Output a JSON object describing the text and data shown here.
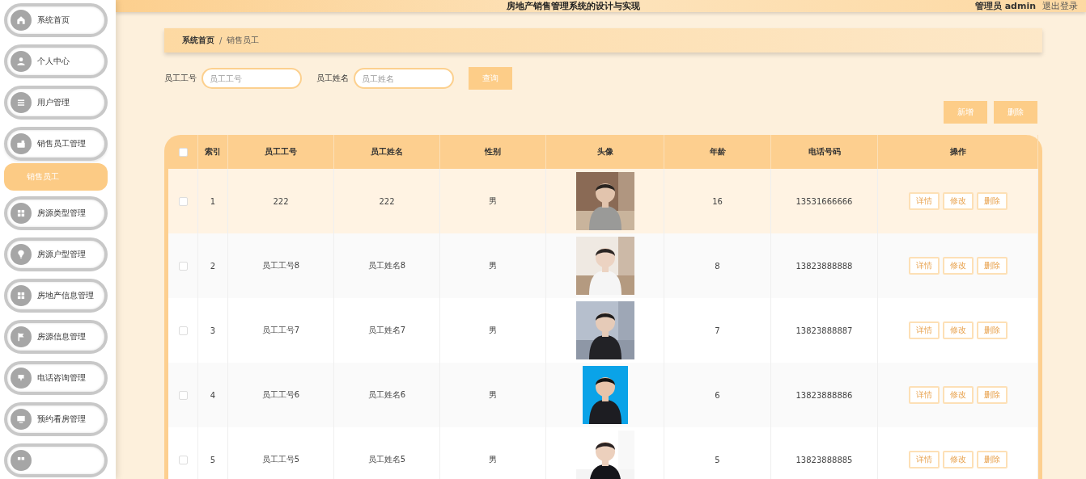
{
  "header": {
    "title": "房地产销售管理系统的设计与实现",
    "user": "管理员 admin",
    "logout": "退出登录"
  },
  "sidebar": {
    "items": [
      {
        "label": "系统首页",
        "selected": false
      },
      {
        "label": "个人中心",
        "selected": false
      },
      {
        "label": "用户管理",
        "selected": false
      },
      {
        "label": "销售员工管理",
        "selected": false,
        "expanded": true,
        "children": [
          {
            "label": "销售员工",
            "selected": true
          }
        ]
      },
      {
        "label": "房源类型管理",
        "selected": false
      },
      {
        "label": "房源户型管理",
        "selected": false
      },
      {
        "label": "房地产信息管理",
        "selected": false
      },
      {
        "label": "房源信息管理",
        "selected": false
      },
      {
        "label": "电话咨询管理",
        "selected": false
      },
      {
        "label": "预约看房管理",
        "selected": false
      },
      {
        "selected": false
      }
    ]
  },
  "breadcrumb": {
    "items": [
      "系统首页",
      "销售员工"
    ],
    "separator": "/"
  },
  "search": {
    "fields": [
      {
        "label": "员工工号",
        "placeholder": "员工工号"
      },
      {
        "label": "员工姓名",
        "placeholder": "员工姓名"
      }
    ],
    "button": "查询"
  },
  "actions": [
    "新增",
    "删除"
  ],
  "table": {
    "all_checked": false,
    "columns": [
      "索引",
      "员工工号",
      "员工姓名",
      "性别",
      "头像",
      "年龄",
      "电话号码",
      "操作"
    ],
    "rows": [
      {
        "checked": false,
        "hover": true,
        "cells": [
          "1",
          "222",
          "222",
          "男",
          {
            "kind": "picture"
          },
          "16",
          "13531666666"
        ],
        "buttons": [
          "详情",
          "修改",
          "删除"
        ]
      },
      {
        "checked": false,
        "hover": false,
        "cells": [
          "2",
          "员工工号8",
          "员工姓名8",
          "男",
          {
            "kind": "picture"
          },
          "8",
          "13823888888"
        ],
        "buttons": [
          "详情",
          "修改",
          "删除"
        ]
      },
      {
        "checked": false,
        "hover": false,
        "cells": [
          "3",
          "员工工号7",
          "员工姓名7",
          "男",
          {
            "kind": "picture"
          },
          "7",
          "13823888887"
        ],
        "buttons": [
          "详情",
          "修改",
          "删除"
        ]
      },
      {
        "checked": false,
        "hover": false,
        "cells": [
          "4",
          "员工工号6",
          "员工姓名6",
          "男",
          {
            "kind": "picture"
          },
          "6",
          "13823888886"
        ],
        "buttons": [
          "详情",
          "修改",
          "删除"
        ]
      },
      {
        "checked": false,
        "hover": false,
        "cells": [
          "5",
          "员工工号5",
          "员工姓名5",
          "男",
          {
            "kind": "picture"
          },
          "5",
          "13823888885"
        ],
        "buttons": [
          "详情",
          "修改",
          "删除"
        ]
      }
    ]
  }
}
